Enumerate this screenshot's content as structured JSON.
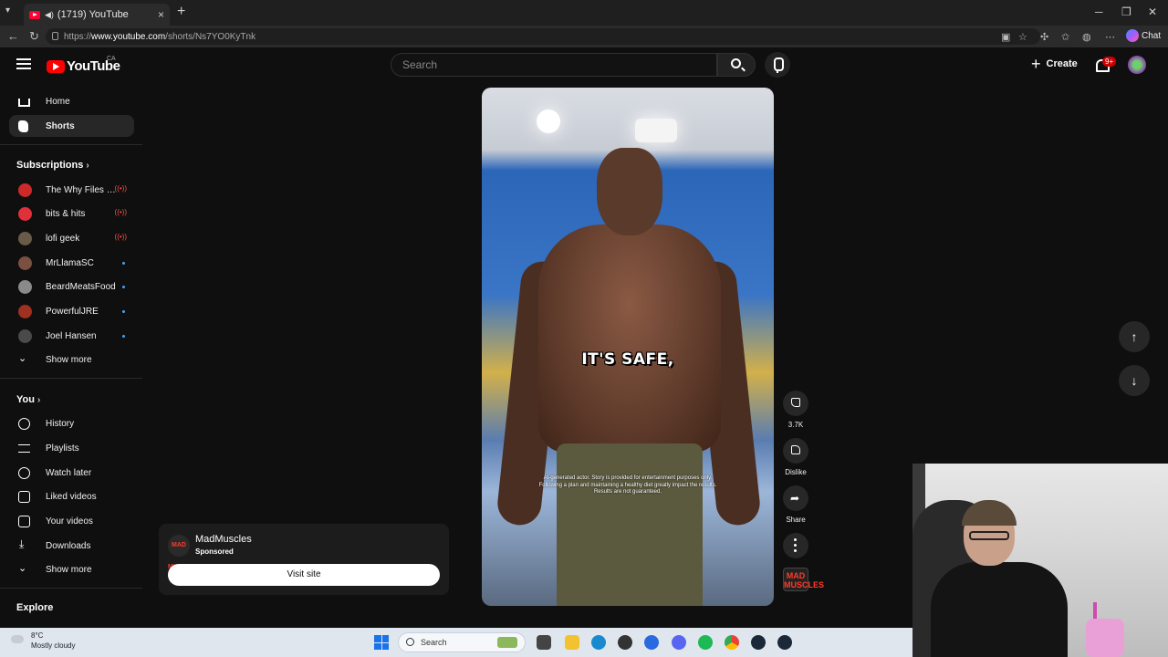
{
  "browser": {
    "tab_title": "(1719) YouTube",
    "new_tab": "+",
    "url_host": "www.youtube.com",
    "url_prefix": "https://",
    "url_path": "/shorts/Ns7YO0KyTnk",
    "chat_label": "Chat",
    "win_min": "─",
    "win_max": "❐",
    "win_close": "✕"
  },
  "youtube": {
    "logo_text": "YouTube",
    "region": "CA",
    "search_placeholder": "Search",
    "create_label": "Create",
    "notification_badge": "9+"
  },
  "sidebar": {
    "main": [
      {
        "label": "Home",
        "icon": "home-icon"
      },
      {
        "label": "Shorts",
        "icon": "shorts-icon",
        "active": true
      }
    ],
    "subscriptions_title": "Subscriptions",
    "subscriptions": [
      {
        "label": "The Why Files - B...",
        "status": "live",
        "color": "#cc2a2a"
      },
      {
        "label": "bits & hits",
        "status": "live",
        "color": "#e0303a"
      },
      {
        "label": "lofi geek",
        "status": "live",
        "color": "#6a5a48"
      },
      {
        "label": "MrLlamaSC",
        "status": "new",
        "color": "#7a5040"
      },
      {
        "label": "BeardMeatsFood",
        "status": "new",
        "color": "#8a8a8a"
      },
      {
        "label": "PowerfulJRE",
        "status": "new",
        "color": "#a03020"
      },
      {
        "label": "Joel Hansen",
        "status": "new",
        "color": "#4a4a4a"
      }
    ],
    "subs_show_more": "Show more",
    "you_title": "You",
    "you_items": [
      {
        "label": "History",
        "icon": "history-icon"
      },
      {
        "label": "Playlists",
        "icon": "playlists-icon"
      },
      {
        "label": "Watch later",
        "icon": "watch-later-icon"
      },
      {
        "label": "Liked videos",
        "icon": "liked-videos-icon"
      },
      {
        "label": "Your videos",
        "icon": "your-videos-icon"
      },
      {
        "label": "Downloads",
        "icon": "downloads-icon"
      }
    ],
    "you_show_more": "Show more",
    "explore_title": "Explore"
  },
  "short": {
    "caption": "IT'S SAFE,",
    "disclaimer_line1": "AI-generated actor. Story is provided for entertainment purposes only.",
    "disclaimer_line2": "Following a plan and maintaining a healthy diet greatly impact the results.",
    "disclaimer_line3": "Results are not guaranteed.",
    "like_count": "3.7K",
    "dislike_label": "Dislike",
    "share_label": "Share",
    "channel_logo_text": "MAD MUSCLES"
  },
  "ad": {
    "name": "MadMuscles",
    "sponsored": "Sponsored",
    "cta": "Visit site",
    "logo_text": "MAD MUSCLES"
  },
  "taskbar": {
    "temp": "8°C",
    "weather": "Mostly cloudy",
    "search_label": "Search"
  }
}
